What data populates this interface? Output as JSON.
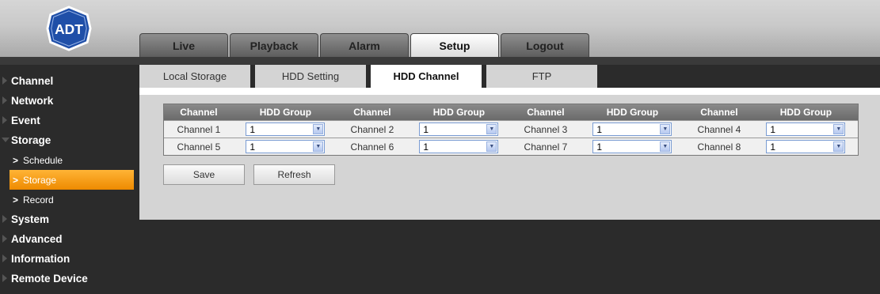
{
  "brand": {
    "logo_text": "ADT"
  },
  "main_tabs": [
    {
      "label": "Live"
    },
    {
      "label": "Playback"
    },
    {
      "label": "Alarm"
    },
    {
      "label": "Setup"
    },
    {
      "label": "Logout"
    }
  ],
  "active_main_tab": "Setup",
  "sidebar": {
    "items": [
      {
        "label": "Channel"
      },
      {
        "label": "Network"
      },
      {
        "label": "Event"
      },
      {
        "label": "Storage",
        "expanded": true,
        "children": [
          {
            "label": "Schedule"
          },
          {
            "label": "Storage",
            "active": true
          },
          {
            "label": "Record"
          }
        ]
      },
      {
        "label": "System"
      },
      {
        "label": "Advanced"
      },
      {
        "label": "Information"
      },
      {
        "label": "Remote Device"
      }
    ]
  },
  "sub_tabs": [
    {
      "label": "Local Storage"
    },
    {
      "label": "HDD Setting"
    },
    {
      "label": "HDD Channel"
    },
    {
      "label": "FTP"
    }
  ],
  "active_sub_tab": "HDD Channel",
  "table": {
    "headers": [
      "Channel",
      "HDD Group",
      "Channel",
      "HDD Group",
      "Channel",
      "HDD Group",
      "Channel",
      "HDD Group"
    ],
    "rows": [
      [
        {
          "channel": "Channel 1",
          "group": "1"
        },
        {
          "channel": "Channel 2",
          "group": "1"
        },
        {
          "channel": "Channel 3",
          "group": "1"
        },
        {
          "channel": "Channel 4",
          "group": "1"
        }
      ],
      [
        {
          "channel": "Channel 5",
          "group": "1"
        },
        {
          "channel": "Channel 6",
          "group": "1"
        },
        {
          "channel": "Channel 7",
          "group": "1"
        },
        {
          "channel": "Channel 8",
          "group": "1"
        }
      ]
    ]
  },
  "buttons": {
    "save": "Save",
    "refresh": "Refresh"
  },
  "colors": {
    "accent": "#f29a1a",
    "active_tab": "#ffffff",
    "dark_bg": "#2b2b2b",
    "panel_bg": "#d4d4d4"
  }
}
